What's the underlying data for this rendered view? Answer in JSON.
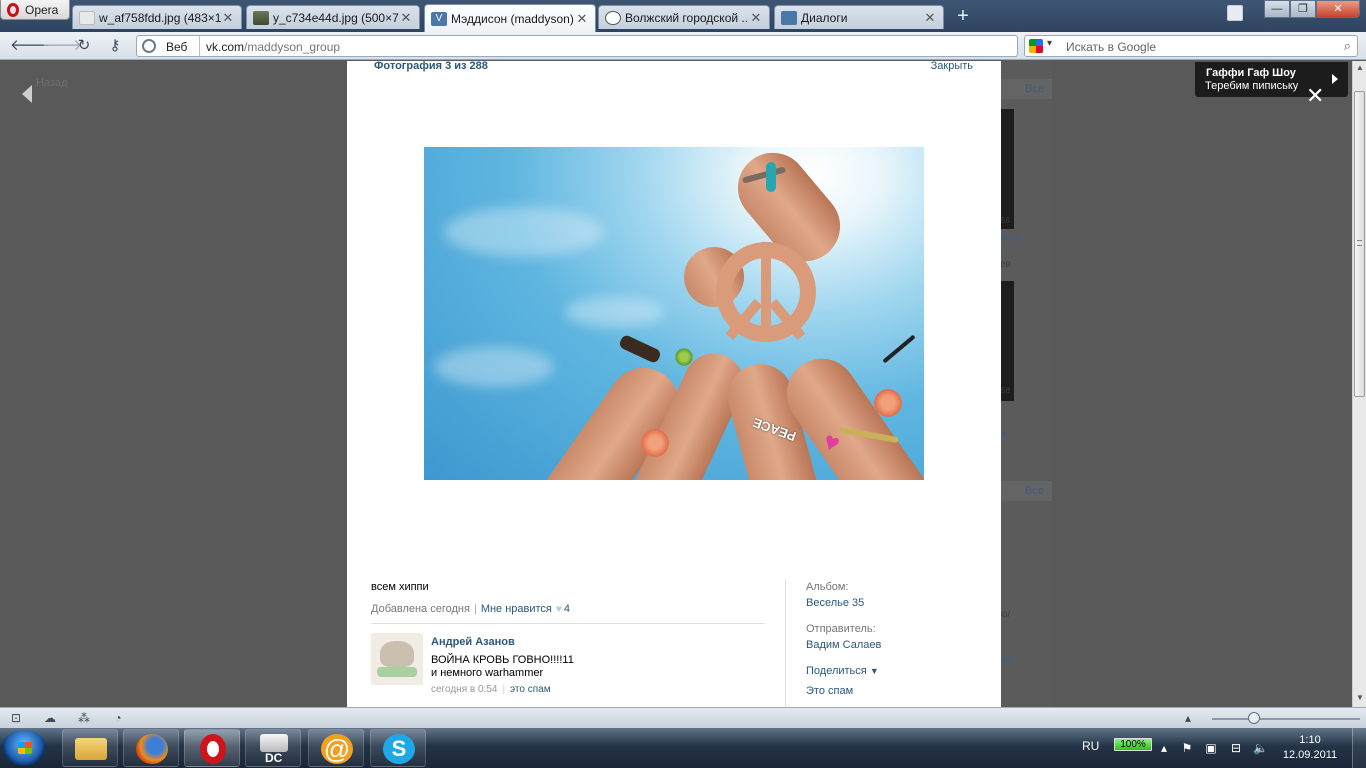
{
  "browser": {
    "menu_label": "Opera",
    "tabs": [
      {
        "title": "w_af758fdd.jpg (483×1...",
        "active": false
      },
      {
        "title": "y_c734e44d.jpg (500×7...",
        "active": false
      },
      {
        "title": "Мэддисон (maddyson)...",
        "active": true
      },
      {
        "title": "Волжский городской ...",
        "active": false
      },
      {
        "title": "Диалоги",
        "active": false
      }
    ],
    "new_tab": "+",
    "window_controls": {
      "minimize": "—",
      "maximize": "❐",
      "close": "✕"
    },
    "address": {
      "mode": "Веб",
      "host": "vk.com",
      "path": "/maddyson_group"
    },
    "search": {
      "placeholder": "Искать в Google"
    }
  },
  "page": {
    "back_label": "Назад",
    "photo_counter": "Фотография 3 из 288",
    "close_label": "Закрыть",
    "caption": "всем хиппи",
    "added": "Добавлена сегодня",
    "like_label": "Мне нравится",
    "like_count": "4",
    "photo_words": {
      "peace": "PEACE"
    },
    "comment": {
      "author": "Андрей Азанов",
      "text_line1": "ВОЙНА КРОВЬ ГОВНО!!!!11",
      "text_line2": "и немного warhammer",
      "time": "сегодня в 0:54",
      "spam_label": "это спам"
    },
    "sidebar": {
      "album_label": "Альбом:",
      "album_value": "Веселье 35",
      "sender_label": "Отправитель:",
      "sender_value": "Вадим Салаев",
      "share_label": "Поделиться",
      "spam_label": "Это спам"
    },
    "behind": {
      "all_label_1": "Все",
      "all_label_2": "Все",
      "snippet_1": "ence",
      "snippet_2": "]",
      "snippet_3": "ев",
      "snippet_4": "56",
      "snippet_5": "58",
      "snippet_6": "й",
      "snippet_7": "ю/",
      "snippet_8": "ий"
    }
  },
  "notification": {
    "title": "Гаффи Гаф Шоу",
    "text": "Теребим пипиську"
  },
  "taskbar": {
    "language": "RU",
    "battery": "100%",
    "time": "1:10",
    "date": "12.09.2011",
    "dc_label": "DC"
  },
  "colors": {
    "vk_link": "#2b587a",
    "overlay": "#595959",
    "opera_red": "#cc0f16"
  }
}
